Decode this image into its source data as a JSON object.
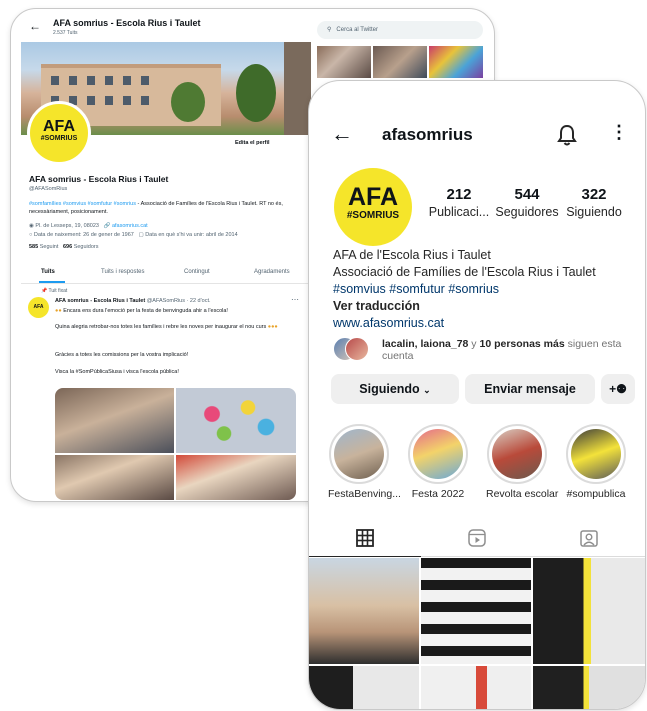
{
  "twitter": {
    "back_icon": "arrow-left-icon",
    "name": "AFA somrius - Escola Rius i Taulet",
    "tweet_count": "2.537 Tuits",
    "search_placeholder": "Cerca al Twitter",
    "avatar_line1": "AFA",
    "avatar_line2": "#SOMRIUS",
    "edit_profile": "Edita el perfil",
    "handle": "@AFASomRius",
    "bio_tags": "#somfamílies #somvius #somfutur #somrius",
    "bio_text": " - Associació de Famílies de l'Escola Rius i Taulet. RT no és, necessàriament, posicionament.",
    "location": "Pl. de Lesseps, 19, 08023",
    "website": "afasomrius.cat",
    "birthday": "Data de naixement: 26 de gener de 1967",
    "joined": "Data en què s'hi va unir: abril de 2014",
    "following_count": "585",
    "following_label": "Seguint",
    "followers_count": "696",
    "followers_label": "Seguidors",
    "tabs": [
      "Tuits",
      "Tuits i respostes",
      "Contingut",
      "Agradaments"
    ],
    "pinned_label": "Tuit fixat",
    "tweet_author": "AFA somrius - Escola Rius i Taulet",
    "tweet_meta": "@AFASomRius · 22 d'oct.",
    "tweet_lines": [
      "Encara ens dura l'emoció per la festa de benvinguda ahir a l'escola!",
      "Quina alegria retrobar-nos totes les famílies i rebre les noves per inaugurar el nou curs",
      "Gràcies a totes les comissions per la vostra implicació!",
      "Visca la #SomPúblicaSiusa i visca l'escola pública!"
    ],
    "more_icon": "more-horizontal-icon"
  },
  "instagram": {
    "username": "afasomrius",
    "back_icon": "arrow-left-icon",
    "bell_icon": "bell-icon",
    "more_icon": "more-vertical-icon",
    "avatar_line1": "AFA",
    "avatar_line2": "#SOMRIUS",
    "stats": [
      {
        "number": "212",
        "label": "Publicaci..."
      },
      {
        "number": "544",
        "label": "Seguidores"
      },
      {
        "number": "322",
        "label": "Siguiendo"
      }
    ],
    "name": "AFA de l'Escola Rius i Taulet",
    "description": "Associació de Famílies de l'Escola Rius i Taulet",
    "hashtags": "#somvius #somfutur #somrius",
    "translate": "Ver traducción",
    "website": "www.afasomrius.cat",
    "followed_by_names": "lacalin, laiona_78",
    "followed_by_mid": " y ",
    "followed_by_more": "10 personas más",
    "followed_by_tail": " siguen esta cuenta",
    "btn_following": "Siguiendo",
    "btn_message": "Enviar mensaje",
    "btn_add_icon": "add-person-icon",
    "highlights": [
      "FestaBenving...",
      "Festa 2022",
      "Revolta escolar",
      "#sompublica"
    ],
    "tab_icons": [
      "grid-icon",
      "reels-icon",
      "tagged-icon"
    ]
  }
}
